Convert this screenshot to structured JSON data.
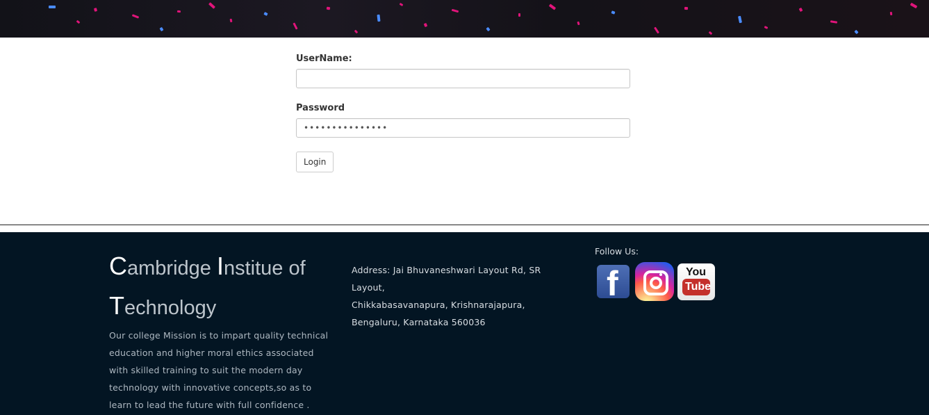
{
  "login": {
    "username_label": "UserName:",
    "username_value": "",
    "password_label": "Password",
    "password_value": "•••••••••••••••",
    "login_label": "Login"
  },
  "footer": {
    "brand_c": "C",
    "brand_ambridge": "ambridge ",
    "brand_i": "I",
    "brand_nstitue": "nstitue of",
    "brand_t": "T",
    "brand_echnology": "echnology",
    "mission": "Our college Mission is to impart quality technical education and higher moral ethics associated with skilled training to suit the modern day technology with innovative concepts,so as to learn to lead the future with full confidence .",
    "address_line1": "Address: Jai Bhuvaneshwari Layout Rd, SR Layout,",
    "address_line2": "Chikkabasavanapura, Krishnarajapura,",
    "address_line3": "Bengaluru, Karnataka 560036",
    "follow_label": "Follow Us:",
    "social": {
      "facebook_glyph": "f",
      "youtube_you": "You",
      "youtube_tube": "Tube"
    }
  },
  "colors": {
    "footer_bg": "#031523",
    "banner_sparkle": "#e0147a"
  }
}
